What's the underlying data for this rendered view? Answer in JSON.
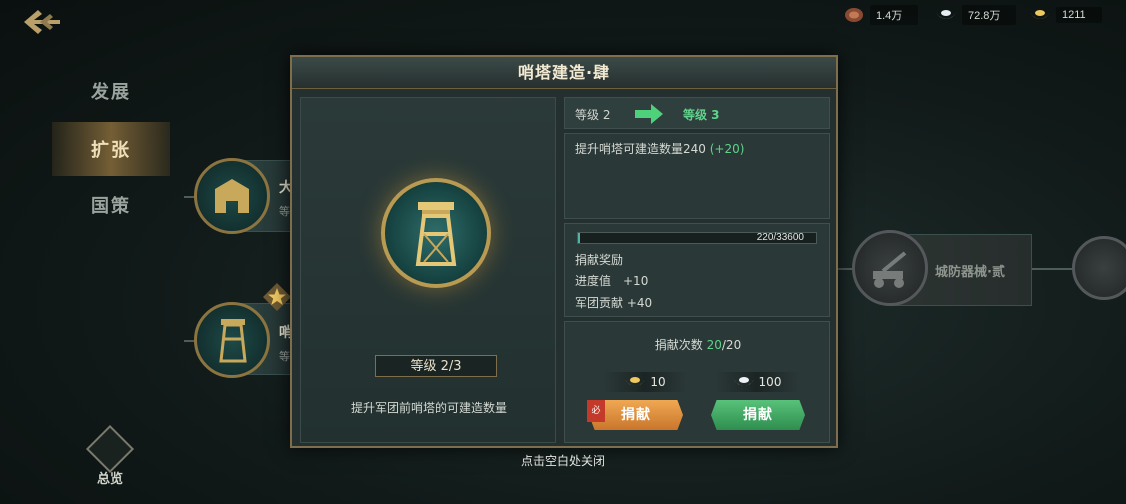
{
  "resources": [
    {
      "icon": "meat-icon",
      "amount": "1.4万"
    },
    {
      "icon": "silver-ingot-icon",
      "amount": "72.8万"
    },
    {
      "icon": "gold-ingot-icon",
      "amount": "1211"
    }
  ],
  "sidebar": {
    "items": [
      {
        "label": "发展"
      },
      {
        "label": "扩张"
      },
      {
        "label": "国策"
      }
    ],
    "summary_label": "总览"
  },
  "tree": {
    "node1_label": "大",
    "node1_sub": "等",
    "node2_label": "哨",
    "node2_sub": "等",
    "node3_label": "城防器械·贰"
  },
  "modal": {
    "title": "哨塔建造·肆",
    "level_tag": "等级 2/3",
    "description": "提升军团前哨塔的可建造数量",
    "level_from": "等级 2",
    "level_to": "等级 3",
    "effect_prefix": "提升哨塔可建造数量240 ",
    "effect_bonus": "(+20)",
    "progress": {
      "current": 220,
      "total": 33600,
      "text": "220/33600"
    },
    "reward_title": "捐献奖励",
    "reward_progress": "进度值　+10",
    "reward_contribution": "军团贡献 +40",
    "donate_count_label": "捐献次数 ",
    "donate_count_current": "20",
    "donate_count_total": "/20",
    "gold_cost": "10",
    "silver_cost": "100",
    "donate_gold_label": "捐献",
    "donate_silver_label": "捐献",
    "corner_badge": "必"
  },
  "close_hint": "点击空白处关闭",
  "colors": {
    "accent_green": "#5fd38a",
    "gold_border": "#7e6e4c",
    "orange_button": "#e0913f",
    "green_button": "#3fa862"
  }
}
